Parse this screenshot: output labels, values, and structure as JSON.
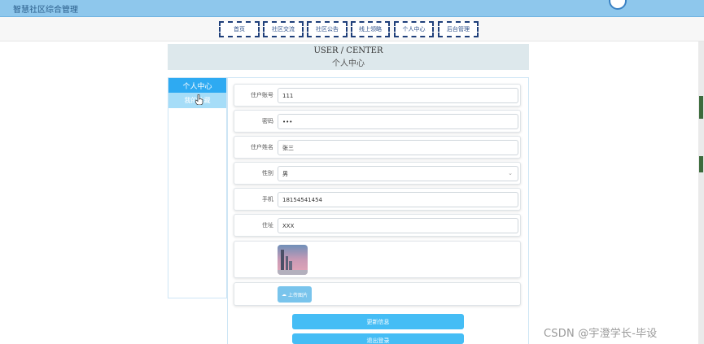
{
  "app": {
    "title": "智慧社区综合管理"
  },
  "nav": [
    "首页",
    "社区交流",
    "社区公告",
    "线上领略",
    "个人中心",
    "后台管理"
  ],
  "header": {
    "en": "USER / CENTER",
    "zh": "个人中心"
  },
  "sidebar": {
    "heading": "个人中心",
    "item": "我的收藏"
  },
  "form": {
    "fields": [
      {
        "label": "住户账号",
        "value": "111"
      },
      {
        "label": "密码",
        "value": "•••"
      },
      {
        "label": "住户姓名",
        "value": "张三"
      },
      {
        "label": "性别",
        "value": "男"
      },
      {
        "label": "手机",
        "value": "18154541454"
      },
      {
        "label": "住址",
        "value": "XXX"
      }
    ],
    "upload_label": "上传图片",
    "update_label": "更新信息",
    "logout_label": "退出登录"
  },
  "watermark": "CSDN @宇澄学长-毕设"
}
